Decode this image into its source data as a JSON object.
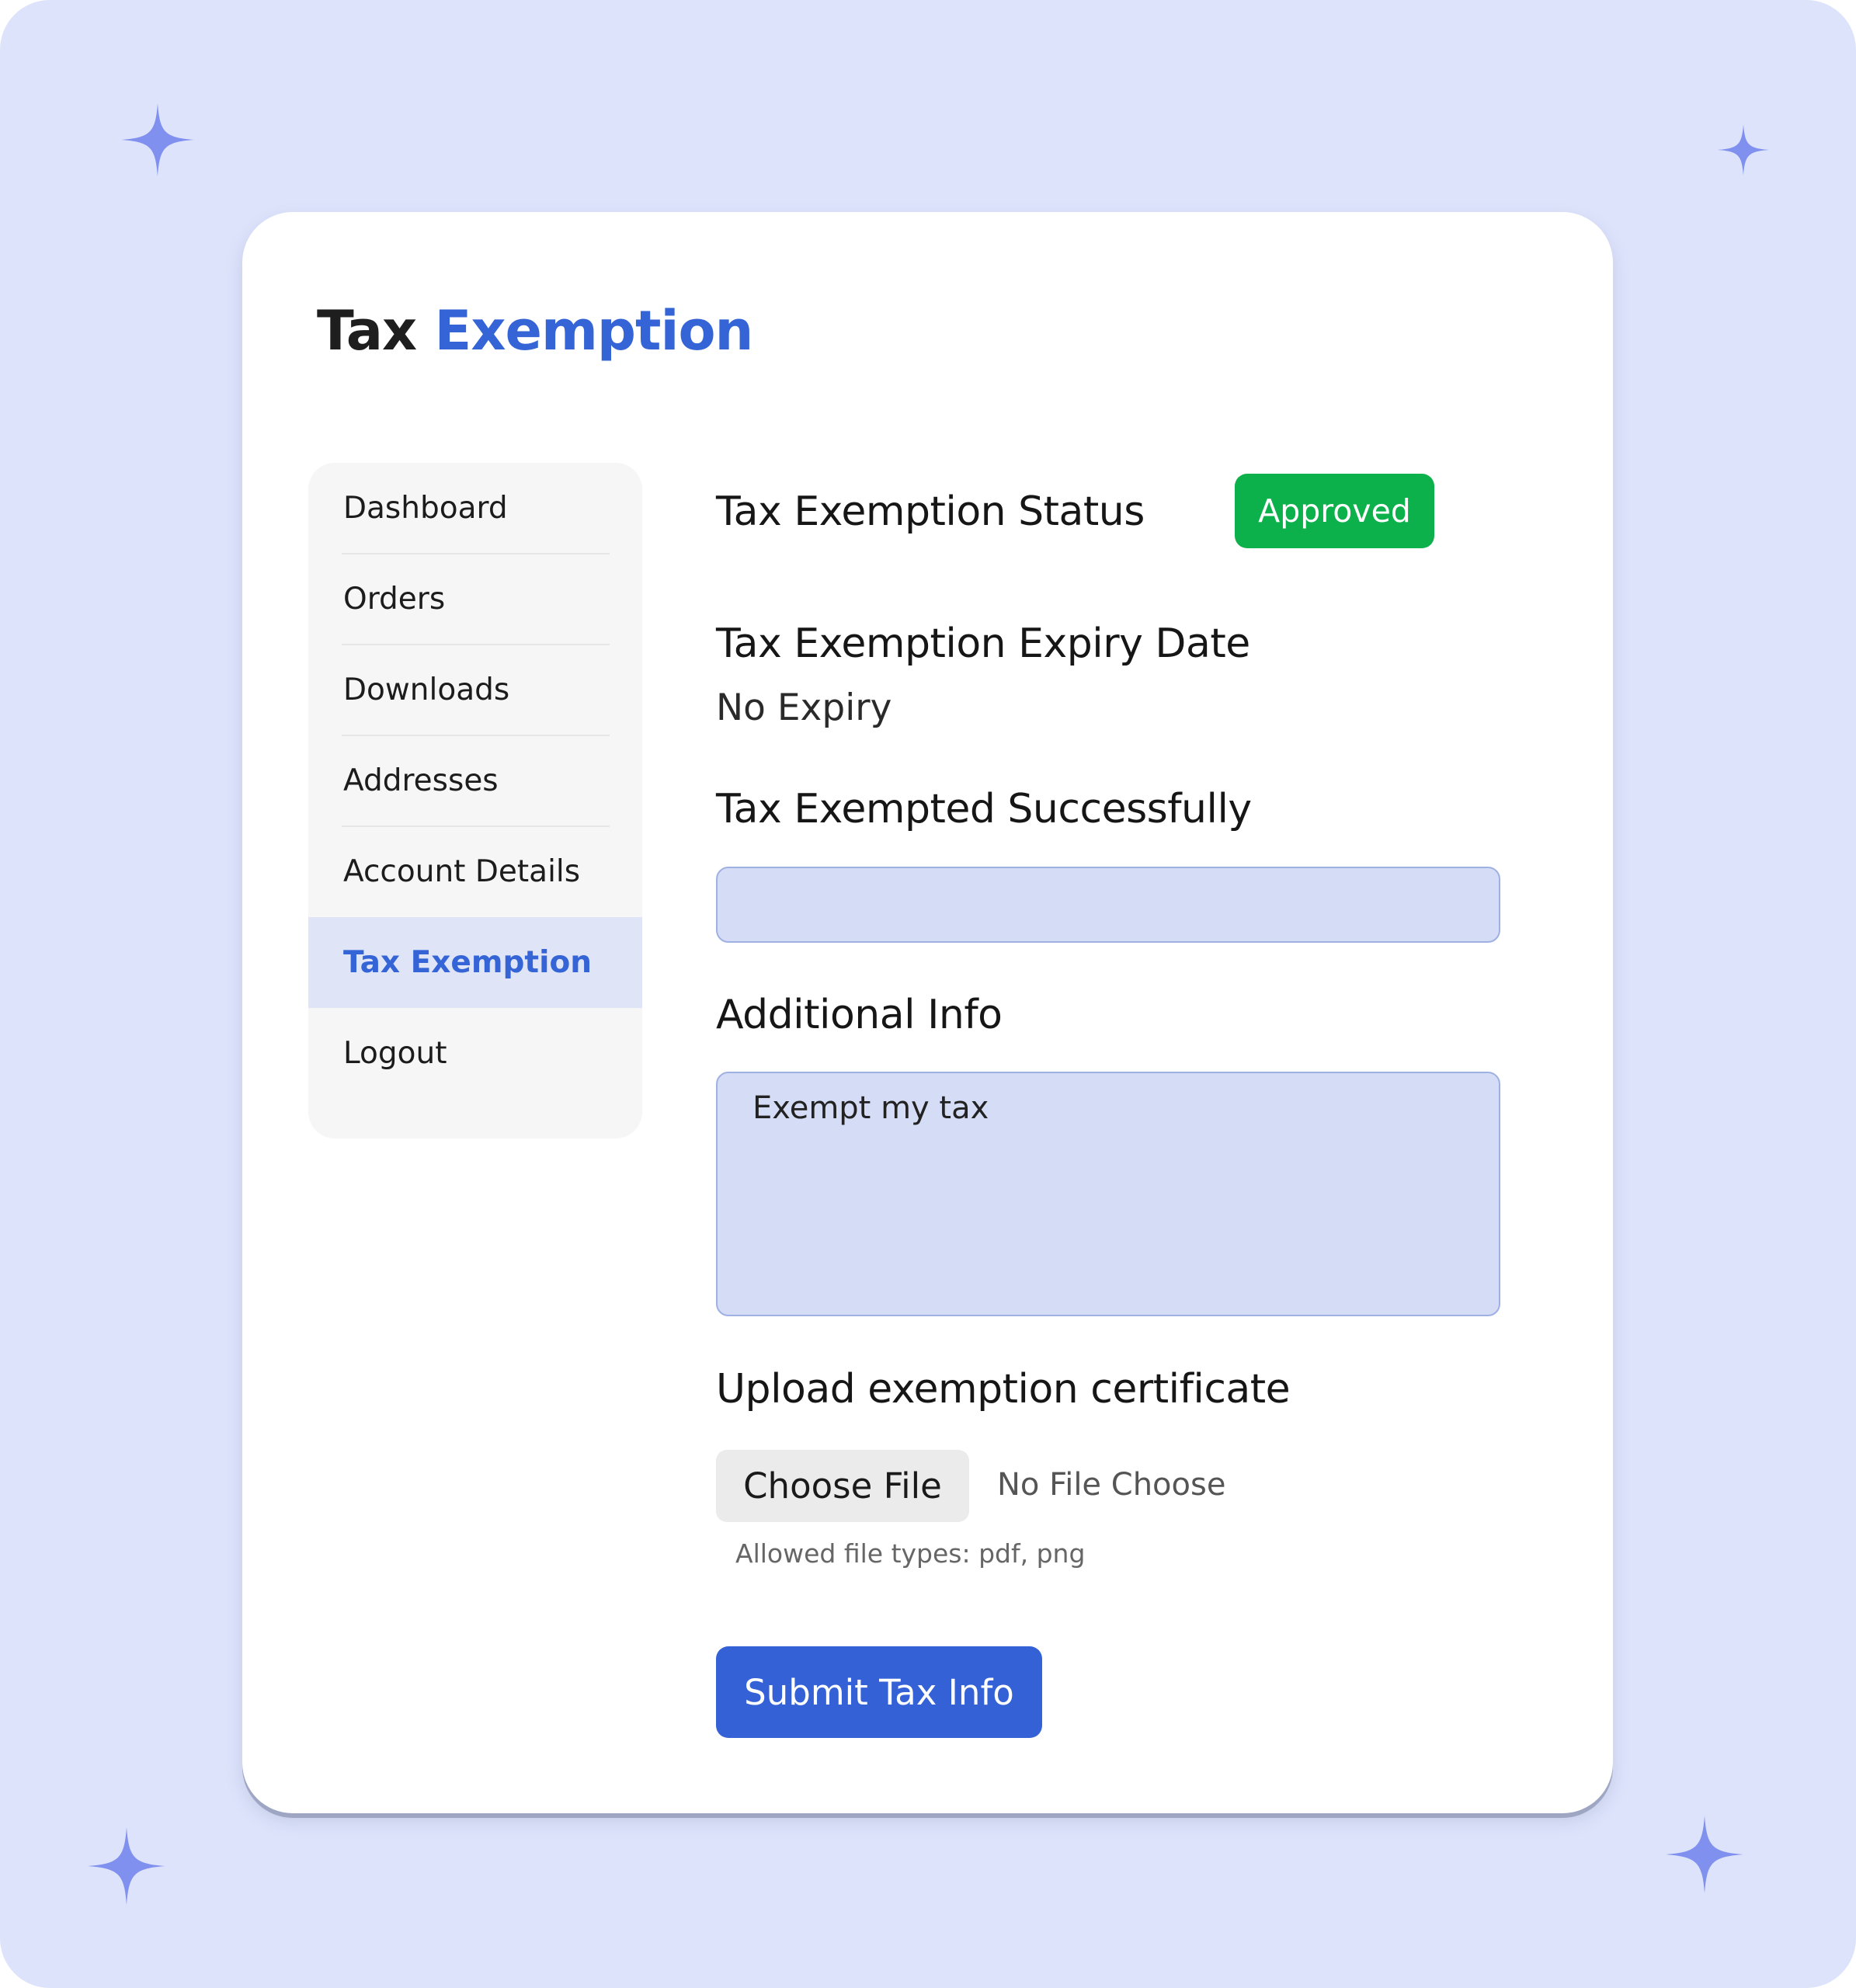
{
  "page": {
    "title_part1": "Tax",
    "title_part2": "Exemption"
  },
  "sidebar": {
    "items": [
      {
        "label": "Dashboard"
      },
      {
        "label": "Orders"
      },
      {
        "label": "Downloads"
      },
      {
        "label": "Addresses"
      },
      {
        "label": "Account Details"
      },
      {
        "label": "Tax Exemption",
        "active": true
      },
      {
        "label": "Logout"
      }
    ]
  },
  "status": {
    "label": "Tax Exemption Status",
    "badge": "Approved"
  },
  "expiry": {
    "label": "Tax Exemption Expiry Date",
    "value": "No Expiry"
  },
  "exempted": {
    "label": "Tax Exempted Successfully",
    "value": ""
  },
  "additional": {
    "label": "Additional Info",
    "value": "Exempt my tax"
  },
  "upload": {
    "label": "Upload exemption certificate",
    "button": "Choose File",
    "status": "No File Choose",
    "hint": "Allowed file types: pdf, png"
  },
  "submit": {
    "label": "Submit Tax Info"
  },
  "colors": {
    "background": "#dde3fb",
    "accent": "#3464d6",
    "approved": "#0db14b",
    "sparkle": "#7f90ee"
  }
}
